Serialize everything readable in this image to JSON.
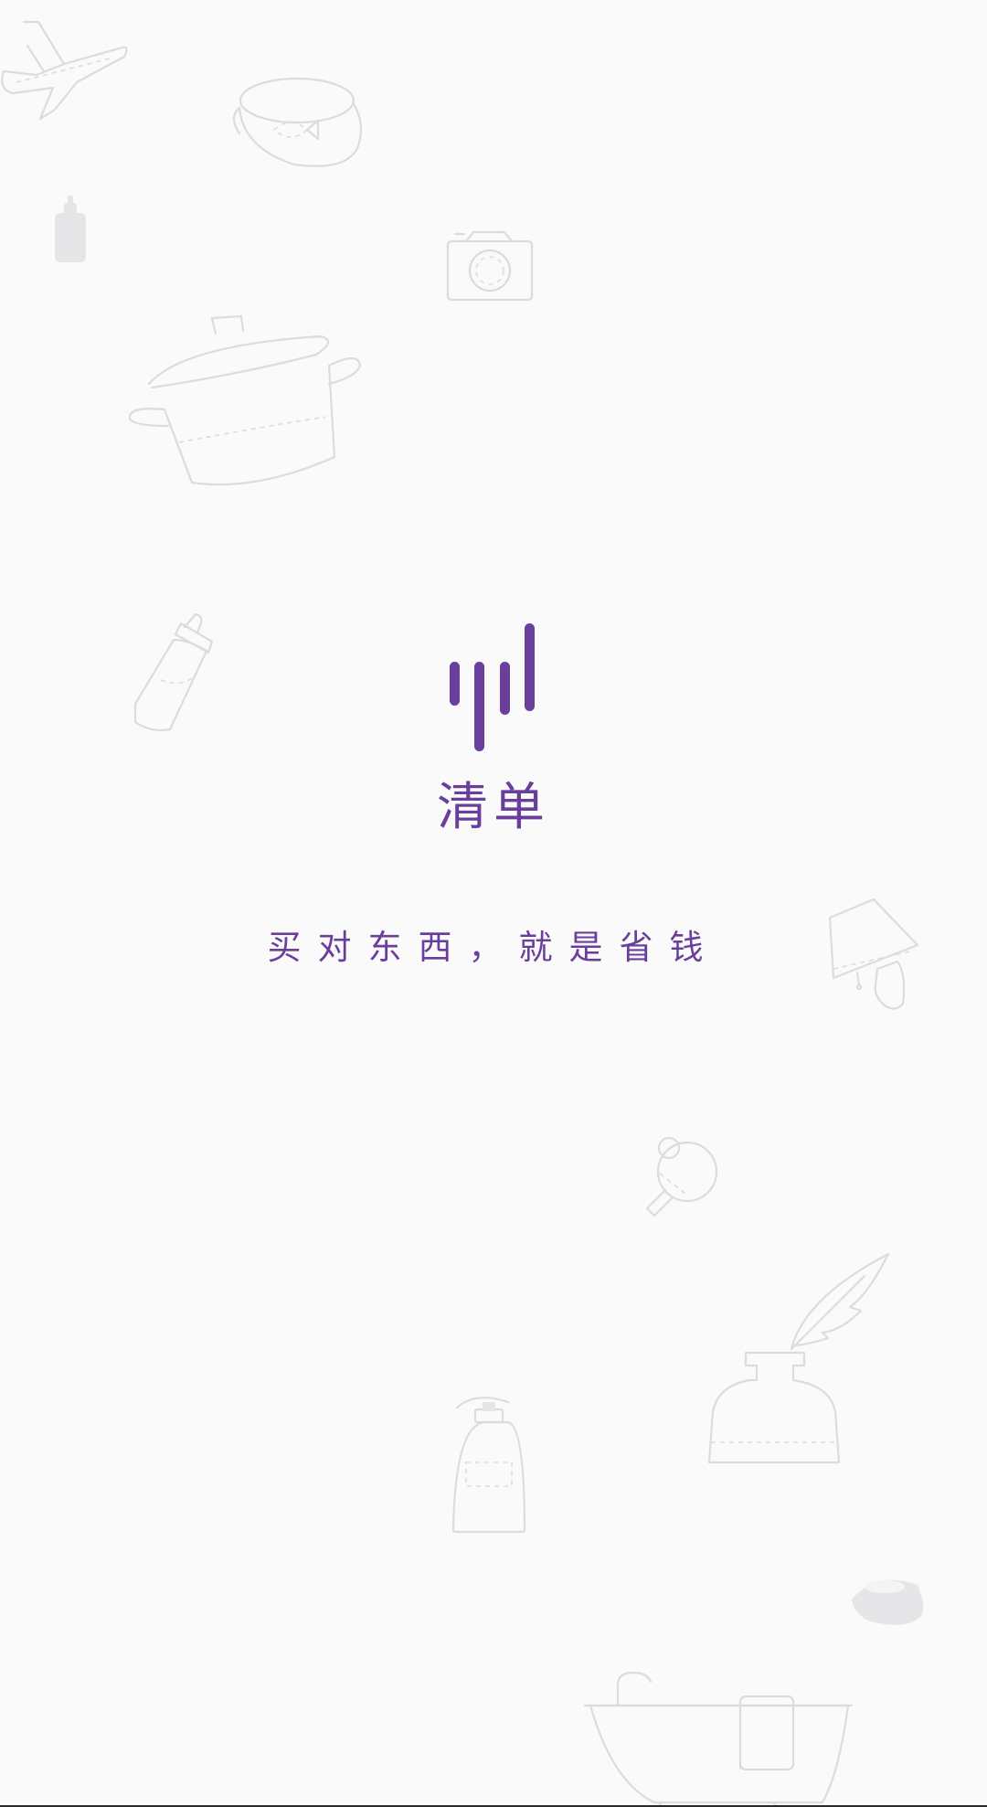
{
  "splash": {
    "app_name": "清单",
    "slogan": "买对东西，就是省钱"
  },
  "colors": {
    "brand": "#6a3f9b",
    "background": "#fafafb",
    "doodle": "#dcdcde"
  },
  "icons": [
    "airplane-icon",
    "pet-bowl-icon",
    "soap-bottle-icon",
    "camera-icon",
    "cooking-pot-icon",
    "baby-bottle-icon",
    "lamp-icon",
    "ping-pong-paddle-icon",
    "ink-bottle-quill-icon",
    "lotion-pump-bottle-icon",
    "small-bowl-icon",
    "bathtub-icon"
  ]
}
